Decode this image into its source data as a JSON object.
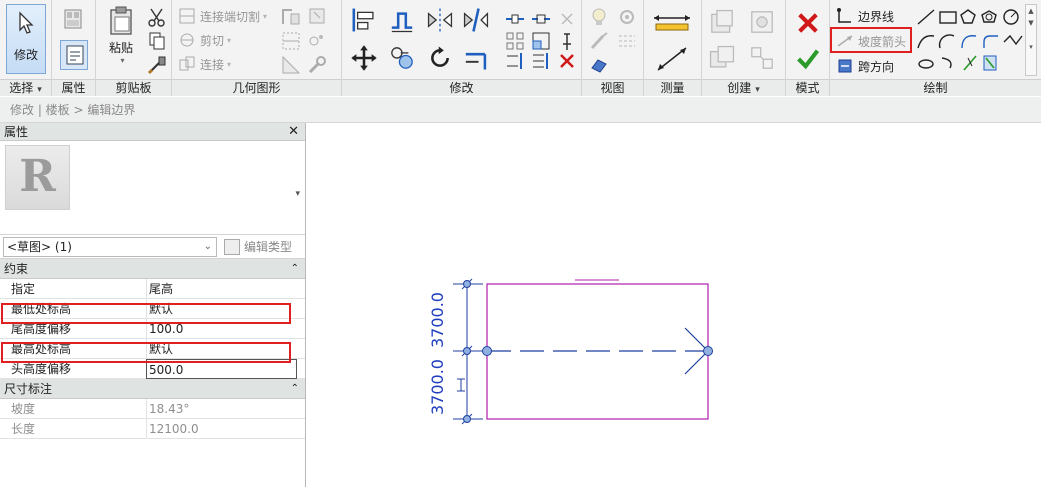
{
  "ribbon": {
    "select": {
      "modify_label": "修改",
      "group_label": "选择"
    },
    "properties": {
      "group_label": "属性"
    },
    "clipboard": {
      "paste_label": "粘贴",
      "group_label": "剪贴板"
    },
    "geometry": {
      "join_cut_label": "连接端切割",
      "cut_label": "剪切",
      "join_label": "连接",
      "group_label": "几何图形"
    },
    "modify": {
      "group_label": "修改"
    },
    "view": {
      "group_label": "视图"
    },
    "measure": {
      "group_label": "测量"
    },
    "create": {
      "group_label": "创建"
    },
    "mode": {
      "group_label": "模式"
    },
    "draw": {
      "boundary_line_label": "边界线",
      "slope_arrow_label": "坡度箭头",
      "span_direction_label": "跨方向",
      "group_label": "绘制"
    }
  },
  "breadcrumb": {
    "text": "修改 | 楼板 > 编辑边界"
  },
  "properties_panel": {
    "title": "属性",
    "close_glyph": "✕",
    "type_logo": "R",
    "selector_value": "<草图> (1)",
    "edit_type_label": "编辑类型",
    "sections": {
      "constraints": {
        "title": "约束",
        "rows": [
          {
            "label": "指定",
            "value": "尾高"
          },
          {
            "label": "最低处标高",
            "value": "默认"
          },
          {
            "label": "尾高度偏移",
            "value": "100.0"
          },
          {
            "label": "最高处标高",
            "value": "默认"
          },
          {
            "label": "头高度偏移",
            "value": "500.0"
          }
        ]
      },
      "dimensions": {
        "title": "尺寸标注",
        "rows": [
          {
            "label": "坡度",
            "value": "18.43°"
          },
          {
            "label": "长度",
            "value": "12100.0"
          }
        ]
      }
    }
  },
  "canvas": {
    "dimension_lower": "3700.0",
    "dimension_upper": "3700.0",
    "colors": {
      "sketch_boundary": "#b01fb0",
      "slope_arrow": "#1f3fa0",
      "dimension_text": "#1f3fbf",
      "highlight": "#e0201e"
    }
  }
}
